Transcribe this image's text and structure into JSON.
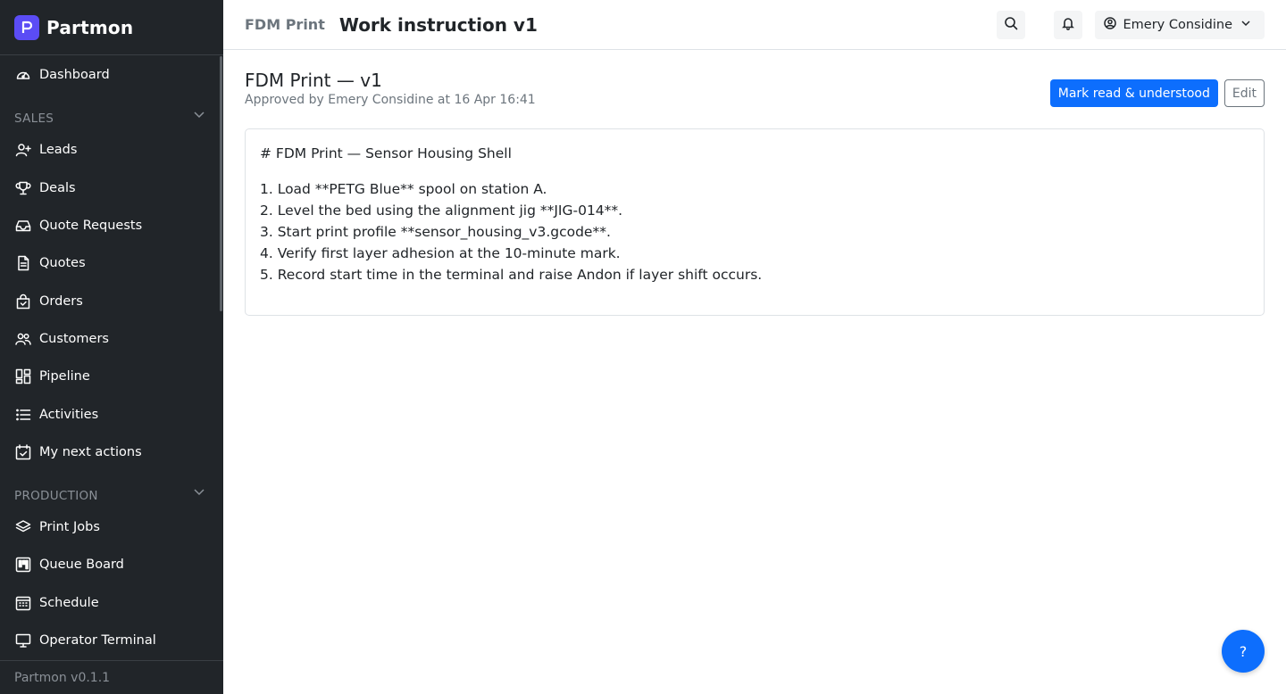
{
  "brand": {
    "name": "Partmon",
    "logo_letter": "P",
    "logo_color": "#5b4cf5"
  },
  "sidebar": {
    "top_items": [
      {
        "label": "Dashboard",
        "icon": "dashboard-gauge-icon"
      }
    ],
    "sections": [
      {
        "title": "SALES",
        "items": [
          {
            "label": "Leads",
            "icon": "user-plus-icon"
          },
          {
            "label": "Deals",
            "icon": "trophy-icon"
          },
          {
            "label": "Quote Requests",
            "icon": "inbox-icon"
          },
          {
            "label": "Quotes",
            "icon": "document-icon"
          },
          {
            "label": "Orders",
            "icon": "bag-check-icon"
          },
          {
            "label": "Customers",
            "icon": "people-icon"
          },
          {
            "label": "Pipeline",
            "icon": "kanban-icon"
          },
          {
            "label": "Activities",
            "icon": "list-icon"
          },
          {
            "label": "My next actions",
            "icon": "calendar-check-icon"
          }
        ]
      },
      {
        "title": "PRODUCTION",
        "items": [
          {
            "label": "Print Jobs",
            "icon": "layers-icon"
          },
          {
            "label": "Queue Board",
            "icon": "board-icon"
          },
          {
            "label": "Schedule",
            "icon": "calendar-grid-icon"
          },
          {
            "label": "Operator Terminal",
            "icon": "monitor-icon"
          }
        ]
      }
    ],
    "version": "Partmon v0.1.1"
  },
  "header": {
    "breadcrumb": "FDM Print",
    "title": "Work instruction v1",
    "user_name": "Emery Considine"
  },
  "document": {
    "title": "FDM Print — v1",
    "approval": "Approved by Emery Considine at 16 Apr 16:41",
    "mark_read_label": "Mark read & understood",
    "edit_label": "Edit",
    "heading": "# FDM Print — Sensor Housing Shell",
    "steps": [
      "1. Load **PETG Blue** spool on station A.",
      "2. Level the bed using the alignment jig **JIG-014**.",
      "3. Start print profile **sensor_housing_v3.gcode**.",
      "4. Verify first layer adhesion at the 10-minute mark.",
      "5. Record start time in the terminal and raise Andon if layer shift occurs."
    ]
  },
  "help": {
    "label": "?"
  },
  "colors": {
    "sidebar_bg": "#212529",
    "primary": "#0d6efd",
    "muted": "#6c757d"
  }
}
